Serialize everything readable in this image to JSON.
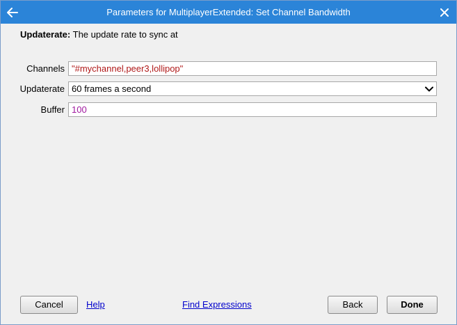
{
  "window": {
    "title": "Parameters for MultiplayerExtended: Set Channel Bandwidth"
  },
  "description": {
    "param_name": "Updaterate:",
    "text": " The update rate to sync at"
  },
  "fields": {
    "channels": {
      "label": "Channels",
      "value": "\"#mychannel,peer3,lollipop\""
    },
    "updaterate": {
      "label": "Updaterate",
      "value": "60 frames a second"
    },
    "buffer": {
      "label": "Buffer",
      "value": "100"
    }
  },
  "footer": {
    "cancel_label": "Cancel",
    "help_label": "Help",
    "find_expressions_label": "Find Expressions",
    "back_label": "Back",
    "done_label": "Done"
  },
  "colors": {
    "titlebar": "#2b84d8",
    "string_value": "#b01919",
    "number_value": "#a0189f",
    "link": "#0000cc"
  },
  "icons": {
    "back": "arrow-left-icon",
    "close": "close-icon",
    "dropdown": "chevron-down-icon"
  }
}
